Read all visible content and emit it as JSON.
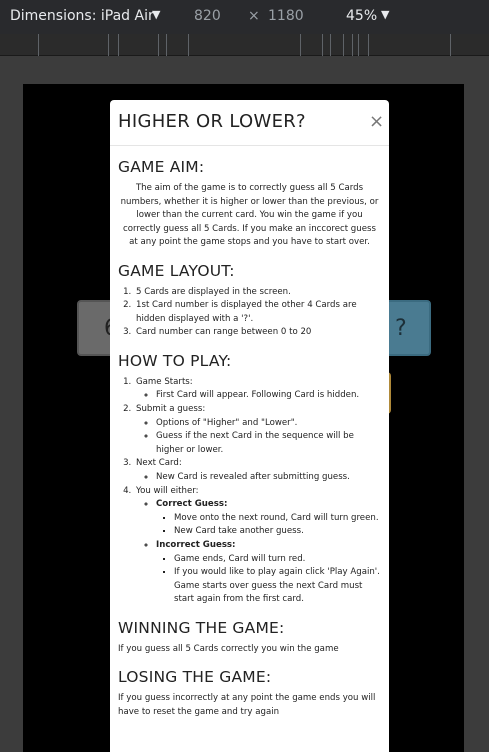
{
  "devtools": {
    "device_label": "Dimensions: iPad Air",
    "width": "820",
    "times": "×",
    "height": "1180",
    "zoom": "45%"
  },
  "game": {
    "card_left": "6",
    "card_right": "?"
  },
  "modal": {
    "title": "HIGHER OR LOWER?",
    "close": "×",
    "aim_heading": "GAME AIM:",
    "aim_text": "The aim of the game is to correctly guess all 5 Cards numbers, whether it is higher or lower than the previous, or lower than the current card. You win the game if you correctly guess all 5 Cards. If you make an inccorect guess at any point the game stops and you have to start over.",
    "layout_heading": "GAME LAYOUT:",
    "layout_items": [
      "5 Cards are displayed in the screen.",
      "1st Card number is displayed the other 4 Cards are hidden displayed with a '?'.",
      "Card number can range between 0 to 20"
    ],
    "howto_heading": "HOW TO PLAY:",
    "howto": {
      "step1": "Game Starts:",
      "step1_sub": "First Card will appear. Following Card is hidden.",
      "step2": "Submit a guess:",
      "step2_sub1": "Options of \"Higher\" and \"Lower\".",
      "step2_sub2": "Guess if the next Card in the sequence will be higher or lower.",
      "step3": "Next Card:",
      "step3_sub": "New Card is revealed after submitting guess.",
      "step4": "You will either:",
      "correct_label": "Correct Guess:",
      "correct_1": "Move onto the next round, Card will turn green.",
      "correct_2": "New Card take another guess.",
      "incorrect_label": "Incorrect Guess:",
      "incorrect_1": "Game ends, Card will turn red.",
      "incorrect_2": "If you would like to play again click 'Play Again'. Game starts over guess the next Card must start again from the first card."
    },
    "win_heading": "WINNING THE GAME:",
    "win_text": "If you guess all 5 Cards correctly you win the game",
    "lose_heading": "LOSING THE GAME:",
    "lose_text": "If you guess incorrectly at any point the game ends you will have to reset the game and try again"
  }
}
